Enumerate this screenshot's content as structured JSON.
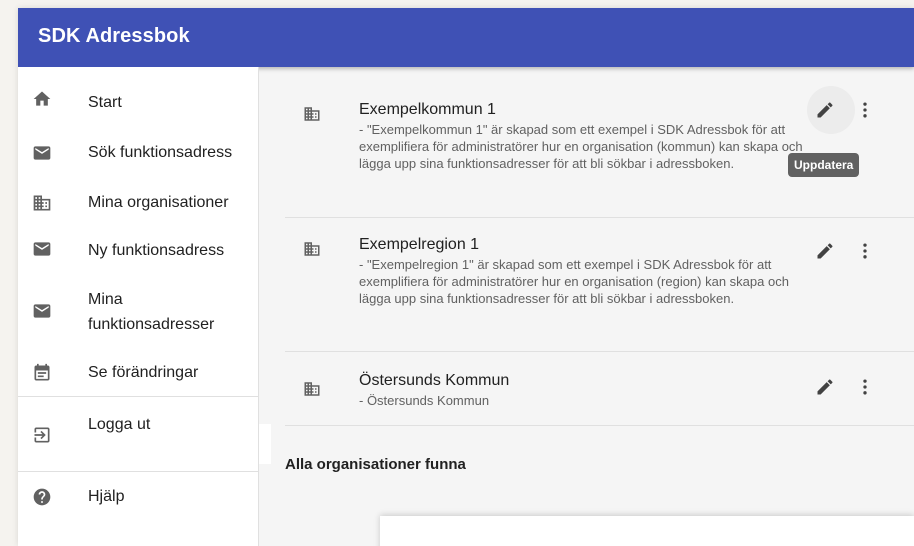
{
  "app": {
    "title": "SDK Adressbok"
  },
  "sidebar": {
    "items": [
      {
        "label": "Start",
        "icon": "home-icon"
      },
      {
        "label": "Sök funktionsadress",
        "icon": "mail-icon"
      },
      {
        "label": "Mina organisationer",
        "icon": "building-icon"
      },
      {
        "label": "Ny funktionsadress",
        "icon": "mail-icon"
      },
      {
        "label": "Mina funktionsadresser",
        "icon": "mail-icon"
      },
      {
        "label": "Se förändringar",
        "icon": "calendar-icon"
      },
      {
        "label": "Logga ut",
        "icon": "logout-icon"
      },
      {
        "label": "Hjälp",
        "icon": "help-icon"
      }
    ]
  },
  "organizations": [
    {
      "name": "Exempelkommun 1",
      "description": " - \"Exempelkommun 1\" är skapad som ett exempel i SDK Adressbok för att exemplifiera för administratörer hur en organisation (kommun) kan skapa och lägga upp sina funktionsadresser för att bli sökbar i adressboken."
    },
    {
      "name": "Exempelregion 1",
      "description": " - \"Exempelregion 1\" är skapad som ett exempel i SDK Adressbok för att exemplifiera för administratörer hur en organisation (region) kan skapa och lägga upp sina funktionsadresser för att bli sökbar i adressboken."
    },
    {
      "name": "Östersunds Kommun",
      "description": " - Östersunds Kommun"
    }
  ],
  "tooltip": "Uppdatera",
  "status": "Alla organisationer funna",
  "colors": {
    "appbar": "#3f51b5",
    "icon": "#616161",
    "tooltip": "#616161"
  }
}
